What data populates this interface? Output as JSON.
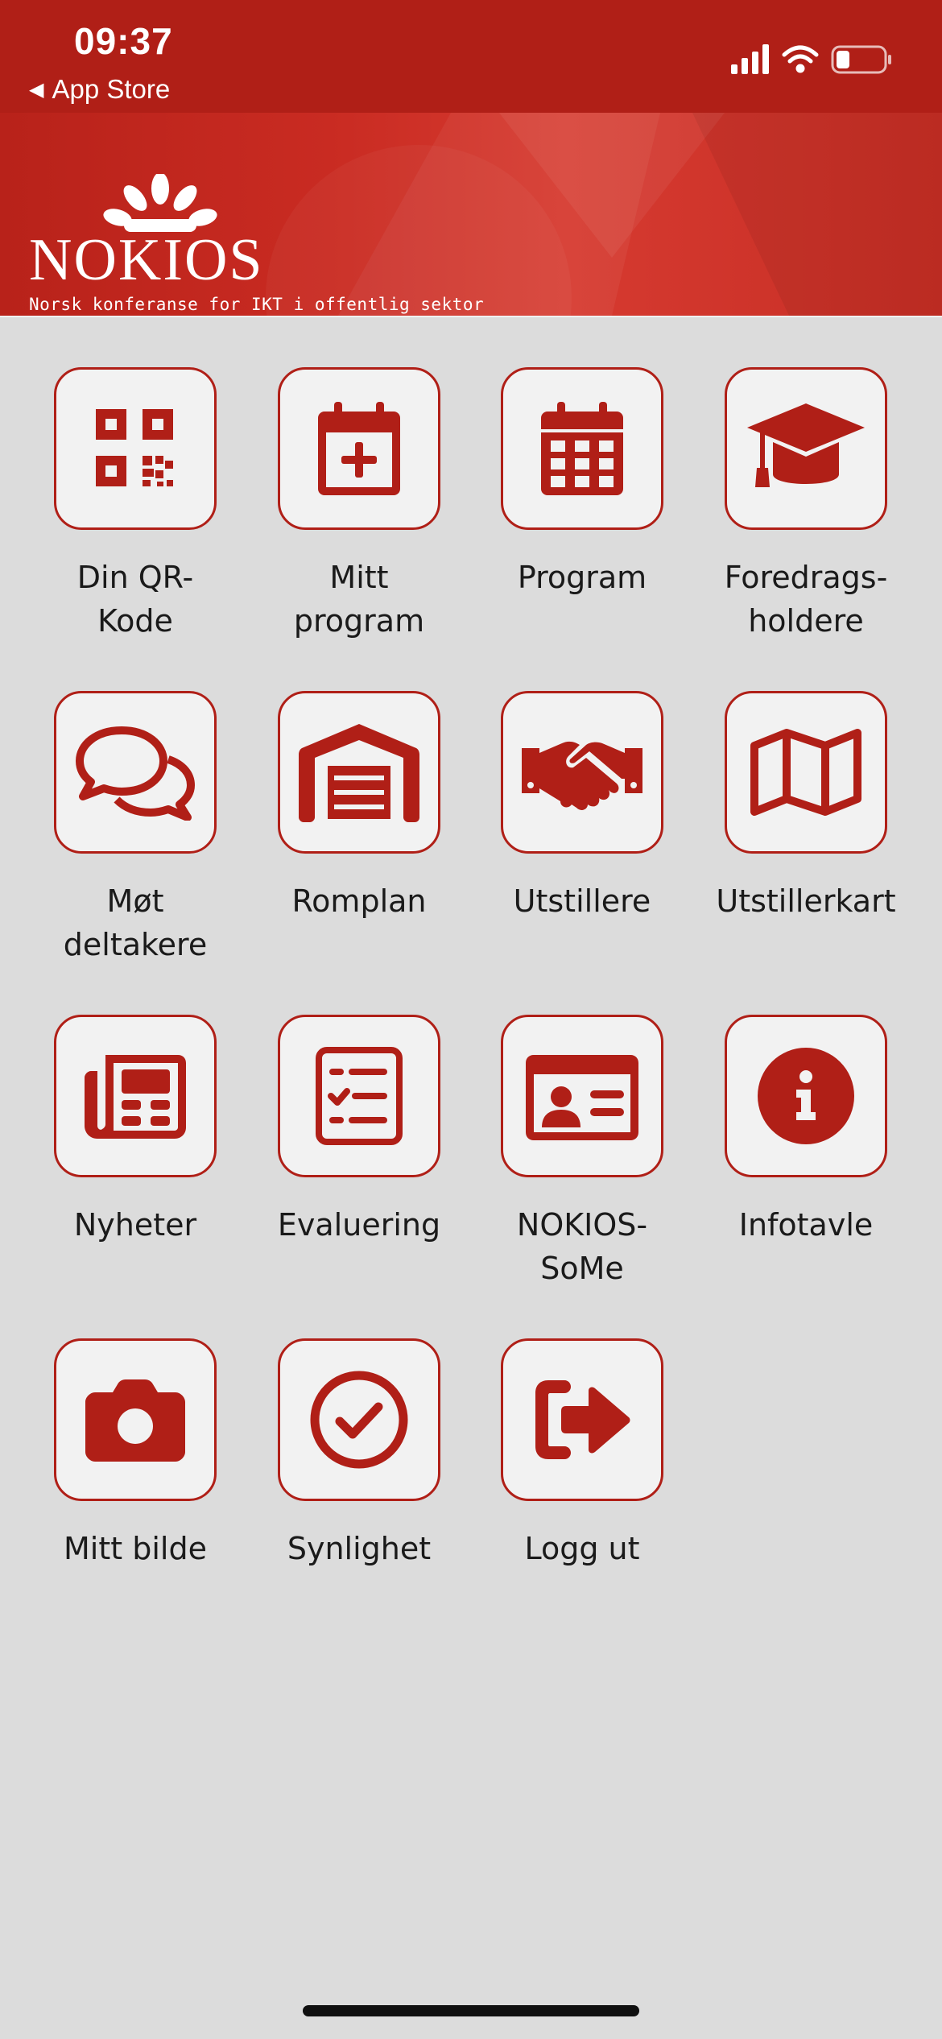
{
  "status": {
    "time": "09:37",
    "back_label": "App Store"
  },
  "header": {
    "brand": "NOKIOS",
    "tagline": "Norsk konferanse for IKT i offentlig sektor"
  },
  "colors": {
    "primary": "#b01f17",
    "tile_bg": "#f2f2f2",
    "page_bg": "#dcdcdc"
  },
  "tiles": [
    {
      "label": "Din QR-\nKode",
      "icon": "qr-code-icon"
    },
    {
      "label": "Mitt\nprogram",
      "icon": "calendar-plus-icon"
    },
    {
      "label": "Program",
      "icon": "calendar-icon"
    },
    {
      "label": "Foredrags-\nholdere",
      "icon": "graduation-cap-icon"
    },
    {
      "label": "Møt\ndeltakere",
      "icon": "chat-bubbles-icon"
    },
    {
      "label": "Romplan",
      "icon": "warehouse-icon"
    },
    {
      "label": "Utstillere",
      "icon": "handshake-icon"
    },
    {
      "label": "Utstillerkart",
      "icon": "map-icon"
    },
    {
      "label": "Nyheter",
      "icon": "newspaper-icon"
    },
    {
      "label": "Evaluering",
      "icon": "checklist-icon"
    },
    {
      "label": "NOKIOS-\nSoMe",
      "icon": "id-card-icon"
    },
    {
      "label": "Infotavle",
      "icon": "info-icon"
    },
    {
      "label": "Mitt bilde",
      "icon": "camera-icon"
    },
    {
      "label": "Synlighet",
      "icon": "check-circle-icon"
    },
    {
      "label": "Logg ut",
      "icon": "logout-icon"
    }
  ]
}
